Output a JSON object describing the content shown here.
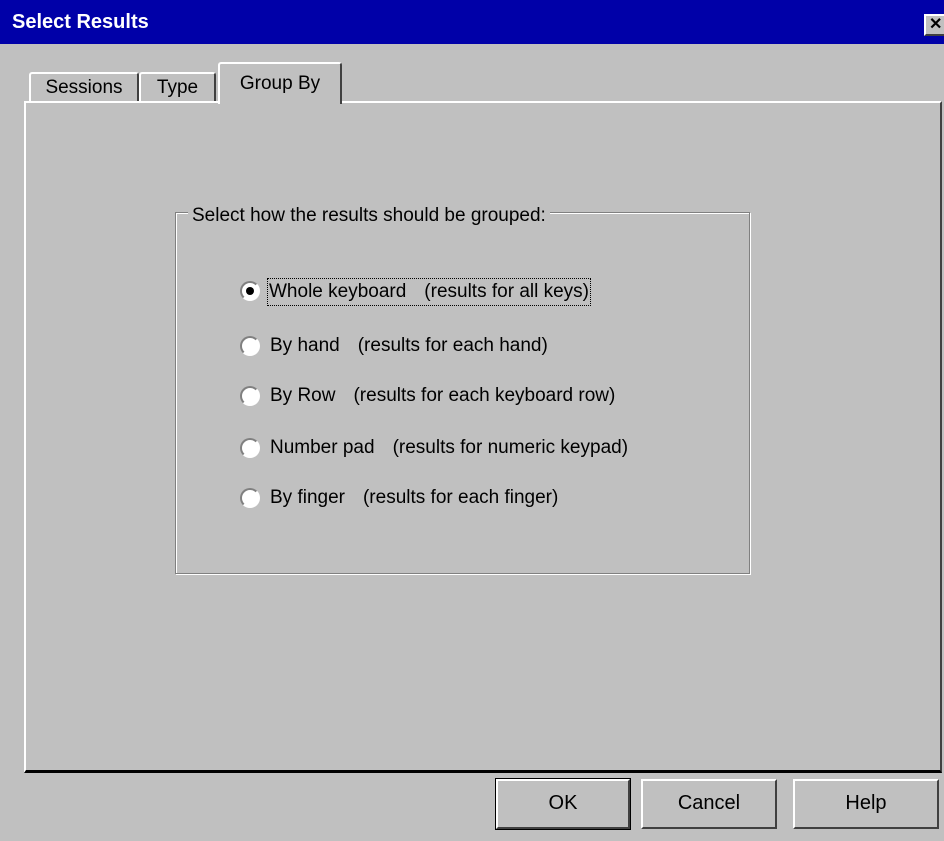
{
  "window": {
    "title": "Select Results",
    "close_glyph": "✕"
  },
  "tabs": [
    {
      "label": "Sessions",
      "selected": false
    },
    {
      "label": "Type",
      "selected": false
    },
    {
      "label": "Group By",
      "selected": true
    }
  ],
  "group": {
    "legend": "Select how the results should be grouped:",
    "options": [
      {
        "label": "Whole keyboard",
        "desc": "(results for all keys)",
        "checked": true
      },
      {
        "label": "By hand",
        "desc": "(results for each hand)",
        "checked": false
      },
      {
        "label": "By Row",
        "desc": "(results for each keyboard row)",
        "checked": false
      },
      {
        "label": "Number pad",
        "desc": "(results for numeric keypad)",
        "checked": false
      },
      {
        "label": "By finger",
        "desc": "(results for each finger)",
        "checked": false
      }
    ]
  },
  "buttons": {
    "ok": "OK",
    "cancel": "Cancel",
    "help": "Help"
  },
  "colors": {
    "face": "#c0c0c0",
    "titlebar": "#0000a8",
    "title_text": "#ffffff"
  }
}
